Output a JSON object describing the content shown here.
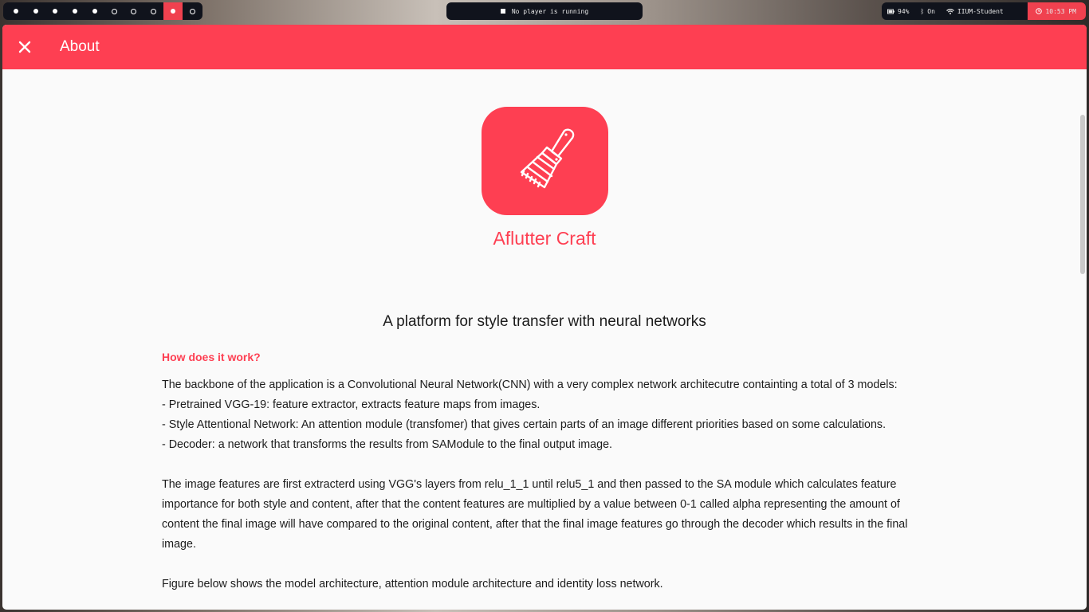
{
  "colors": {
    "accent": "#fe3f52",
    "bar_bg": "#10131c"
  },
  "workspaces": [
    {
      "state": "filled"
    },
    {
      "state": "filled"
    },
    {
      "state": "filled"
    },
    {
      "state": "filled"
    },
    {
      "state": "filled"
    },
    {
      "state": "empty"
    },
    {
      "state": "empty"
    },
    {
      "state": "empty"
    },
    {
      "state": "active"
    },
    {
      "state": "empty"
    }
  ],
  "player": {
    "icon": "stop-icon",
    "text": "No player is running"
  },
  "status": {
    "battery": "94%",
    "bluetooth": "On",
    "wifi": "IIUM-Student",
    "clock": "10:53 PM"
  },
  "appbar": {
    "title": "About",
    "close_icon": "close-icon"
  },
  "about": {
    "logo_icon": "paintbrush-icon",
    "app_name": "Aflutter Craft",
    "tagline": "A platform for style transfer with neural networks",
    "heading": "How does it work?",
    "para1": "The backbone of the application is a Convolutional Neural Network(CNN) with a very complex network architecutre containting a total of 3 models:",
    "bullets": [
      "- Pretrained VGG-19: feature extractor, extracts feature maps from images.",
      "- Style Attentional Network: An attention module (transfomer) that gives certain parts of an image different priorities based on some calculations.",
      "- Decoder: a network that transforms the results from SAModule to the final output image."
    ],
    "para2": "The image features are first extracterd using VGG's layers from relu_1_1 until relu5_1 and then passed to the SA module which calculates feature importance for both style and content, after that the content features are multiplied by a value between 0-1 called alpha representing the amount of content the final image will have compared to the original content, after that the final image features go through the decoder which results in the final image.",
    "para3": "Figure below shows the model architecture, attention module architecture and identity loss network."
  }
}
